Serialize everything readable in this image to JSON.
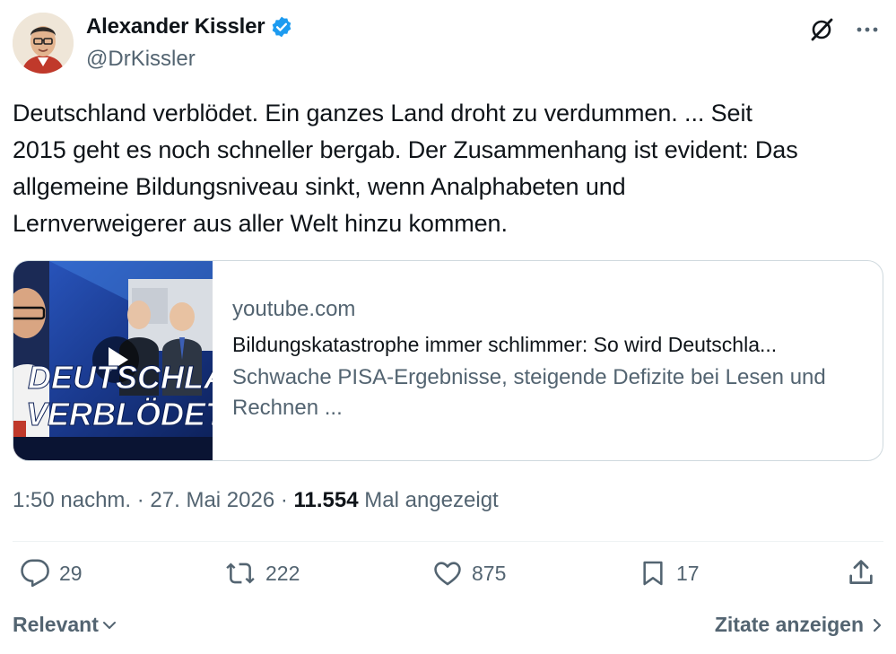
{
  "author": {
    "name": "Alexander Kissler",
    "handle": "@DrKissler",
    "verified_color": "#1d9bf0"
  },
  "tweet": {
    "text": "Deutschland verblödet. Ein ganzes Land droht zu verdummen. ... Seit\n2015 geht es noch schneller bergab. Der Zusammenhang ist evident: Das\nallgemeine Bildungsniveau sinkt, wenn Analphabeten und\nLernverweigerer aus aller Welt hinzu kommen."
  },
  "link_card": {
    "domain": "youtube.com",
    "title": "Bildungskatastrophe immer schlimmer: So wird Deutschla...",
    "description": "Schwache PISA-Ergebnisse, steigende Defizite bei Lesen und Rechnen ...",
    "thumbnail_text_1": "DEUTSCHLA",
    "thumbnail_text_2": "VERBLÖDET"
  },
  "meta": {
    "time": "1:50 nachm.",
    "separator": " · ",
    "date": "27. Mai 2026",
    "views_count": "11.554",
    "views_label": "Mal angezeigt"
  },
  "actions": {
    "replies": "29",
    "reposts": "222",
    "likes": "875",
    "bookmarks": "17"
  },
  "footer": {
    "sort_label": "Relevant",
    "quotes_label": "Zitate anzeigen"
  },
  "icons": {
    "header": [
      "grok-icon",
      "more-icon"
    ],
    "actions": [
      "reply-icon",
      "repost-icon",
      "like-icon",
      "bookmark-icon",
      "share-icon"
    ]
  },
  "colors": {
    "text": "#0f1419",
    "secondary": "#536471",
    "border": "#cfd9de",
    "accent": "#1d9bf0"
  }
}
